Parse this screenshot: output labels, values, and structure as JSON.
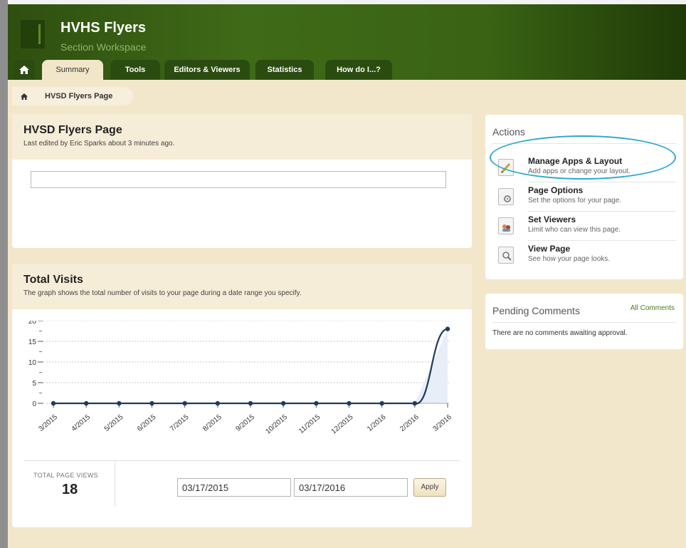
{
  "header": {
    "title": "HVHS Flyers",
    "subtitle": "Section Workspace"
  },
  "tabs": [
    {
      "label": "Summary",
      "active": true
    },
    {
      "label": "Tools"
    },
    {
      "label": "Editors & Viewers"
    },
    {
      "label": "Statistics"
    },
    {
      "label": "How do I...?"
    }
  ],
  "breadcrumb": {
    "label": "HVSD Flyers Page"
  },
  "page_panel": {
    "title": "HVSD Flyers Page",
    "edited": "Last edited by Eric Sparks about 3 minutes ago."
  },
  "visits": {
    "title": "Total Visits",
    "description": "The graph shows the total number of visits to your page during a date range you specify.",
    "total_label": "TOTAL PAGE VIEWS",
    "total_value": "18",
    "start_date": "03/17/2015",
    "end_date": "03/17/2016",
    "apply_label": "Apply"
  },
  "actions": {
    "title": "Actions",
    "items": [
      {
        "title": "Manage Apps & Layout",
        "desc": "Add apps or change your layout.",
        "icon": "pencil-note-icon"
      },
      {
        "title": "Page Options",
        "desc": "Set the options for your page.",
        "icon": "page-gear-icon"
      },
      {
        "title": "Set Viewers",
        "desc": "Limit who can view this page.",
        "icon": "page-users-icon"
      },
      {
        "title": "View Page",
        "desc": "See how your page looks.",
        "icon": "page-magnifier-icon"
      }
    ]
  },
  "comments": {
    "title": "Pending Comments",
    "link": "All Comments",
    "empty": "There are no comments awaiting approval."
  },
  "chart_data": {
    "type": "line",
    "categories": [
      "3/2015",
      "4/2015",
      "5/2015",
      "6/2015",
      "7/2015",
      "8/2015",
      "9/2015",
      "10/2015",
      "11/2015",
      "12/2015",
      "1/2016",
      "2/2016",
      "3/2016"
    ],
    "values": [
      0,
      0,
      0,
      0,
      0,
      0,
      0,
      0,
      0,
      0,
      0,
      0,
      18
    ],
    "yticks": [
      20,
      15,
      10,
      5,
      0
    ],
    "ylim": [
      0,
      20
    ],
    "grid": true,
    "colors": {
      "line": "#1f3b5e",
      "fill": "#e8eef8"
    }
  }
}
